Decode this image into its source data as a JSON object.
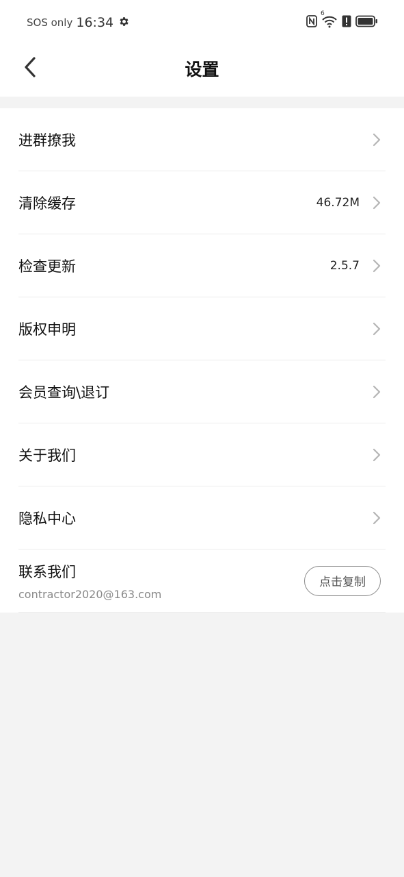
{
  "status_bar": {
    "sos": "SOS only",
    "time": "16:34",
    "icons": [
      "gear-icon",
      "nfc-icon",
      "wifi-icon",
      "alert-icon",
      "battery-icon"
    ],
    "wifi_badge": "6"
  },
  "header": {
    "back_icon": "chevron-left-icon",
    "title": "设置"
  },
  "settings": {
    "items": [
      {
        "label": "进群撩我",
        "value": ""
      },
      {
        "label": "清除缓存",
        "value": "46.72M"
      },
      {
        "label": "检查更新",
        "value": "2.5.7"
      },
      {
        "label": "版权申明",
        "value": ""
      },
      {
        "label": "会员查询\\退订",
        "value": ""
      },
      {
        "label": "关于我们",
        "value": ""
      },
      {
        "label": "隐私中心",
        "value": ""
      }
    ],
    "contact": {
      "label": "联系我们",
      "email": "contractor2020@163.com",
      "copy_button": "点击复制"
    }
  },
  "colors": {
    "background": "#f3f3f3",
    "surface": "#ffffff",
    "text_primary": "#111111",
    "text_secondary": "#888888",
    "divider": "#ececec",
    "chevron": "#b5b5b5"
  }
}
